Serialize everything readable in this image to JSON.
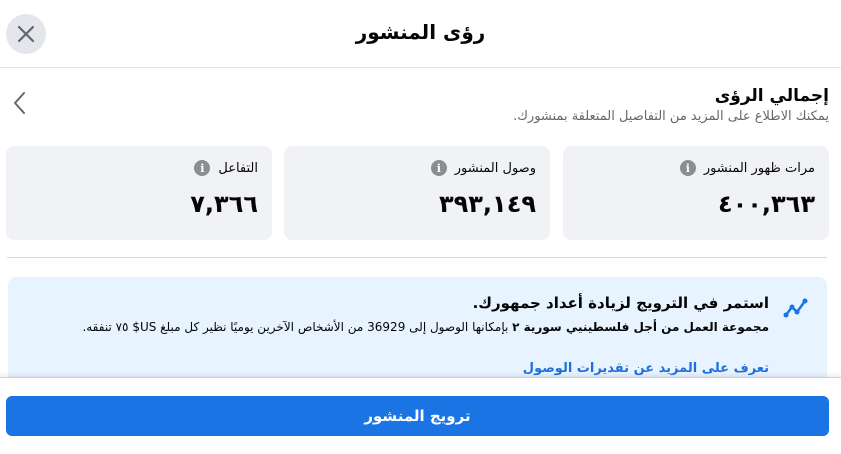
{
  "header": {
    "title": "رؤى المنشور"
  },
  "overview": {
    "title": "إجمالي الرؤى",
    "subtitle": "يمكنك الاطلاع على المزيد من التفاصيل المتعلقة بمنشورك."
  },
  "metrics": [
    {
      "label": "مرات ظهور المنشور",
      "value": "٤٠٠,٣٦٣"
    },
    {
      "label": "وصول المنشور",
      "value": "٣٩٣,١٤٩"
    },
    {
      "label": "التفاعل",
      "value": "٧,٣٦٦"
    }
  ],
  "promo": {
    "title": "استمر في الترويج لزيادة أعداد جمهورك.",
    "page_name": "مجموعة العمل من أجل فلسطينيي سورية ٢",
    "body": " بإمكانها الوصول إلى 36929 من الأشخاص الآخرين يوميًا نظير كل مبلغ US$ ٧٥ تنفقه.",
    "link": "تعرف على المزيد عن تقديرات الوصول"
  },
  "footer": {
    "boost_label": "ترويج المنشور"
  },
  "colors": {
    "primary_blue": "#1b74e4",
    "link_blue": "#216fdb",
    "card_bg": "#f0f2f5",
    "promo_bg": "#e7f3ff"
  }
}
